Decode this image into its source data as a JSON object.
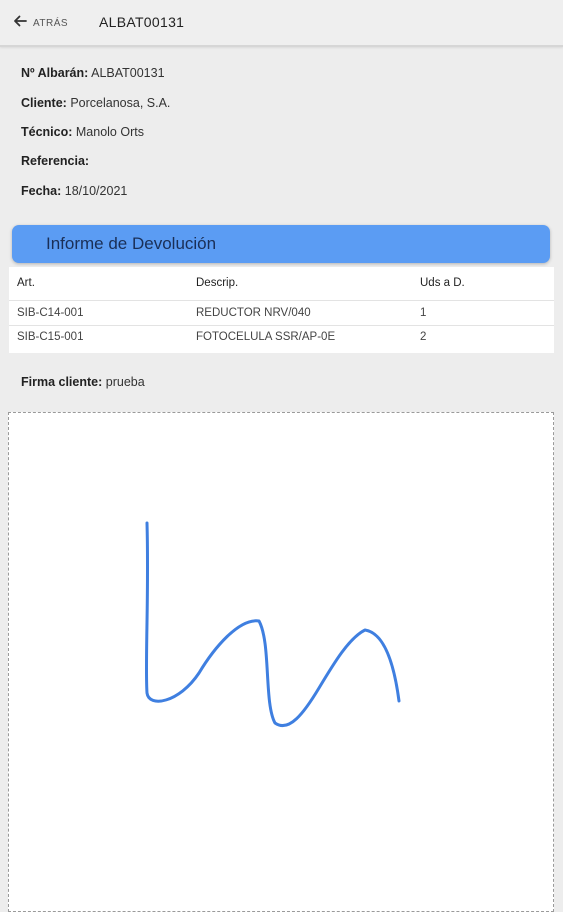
{
  "header": {
    "back_label": "ATRÁS",
    "title": "ALBAT00131"
  },
  "info": {
    "albaran_label": "Nº Albarán:",
    "albaran_value": "ALBAT00131",
    "cliente_label": "Cliente:",
    "cliente_value": "Porcelanosa, S.A.",
    "tecnico_label": "Técnico:",
    "tecnico_value": "Manolo Orts",
    "referencia_label": "Referencia:",
    "referencia_value": "",
    "fecha_label": "Fecha:",
    "fecha_value": "18/10/2021"
  },
  "report": {
    "title": "Informe de Devolución",
    "columns": [
      "Art.",
      "Descrip.",
      "Uds a D."
    ],
    "rows": [
      [
        "SIB-C14-001",
        "REDUCTOR NRV/040",
        "1"
      ],
      [
        "SIB-C15-001",
        "FOTOCELULA SSR/AP-0E",
        "2"
      ]
    ]
  },
  "signature": {
    "label": "Firma cliente:",
    "value": "prueba",
    "stroke_color": "#3f7fe0"
  },
  "colors": {
    "accent": "#5b9cf3",
    "background": "#ededed"
  }
}
